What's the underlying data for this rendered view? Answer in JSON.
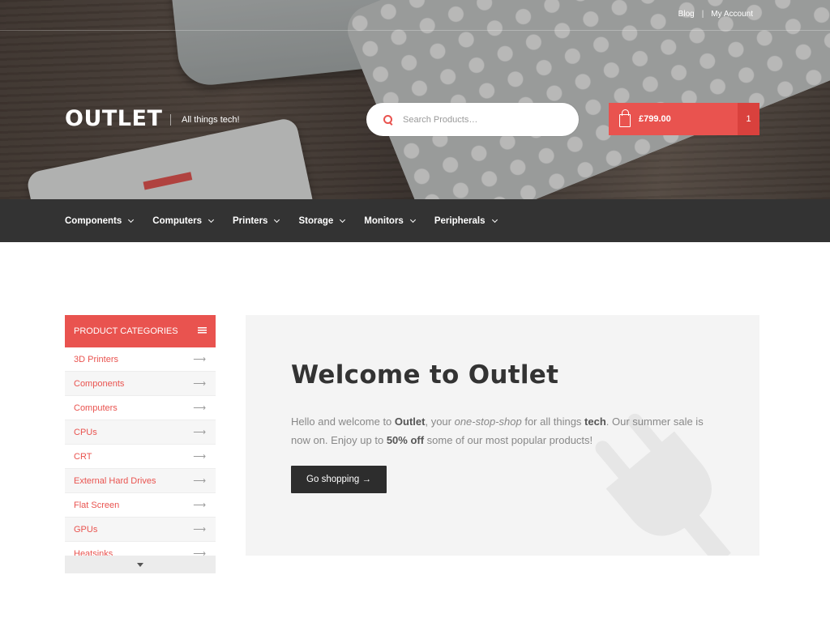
{
  "top_links": {
    "blog": "Blog",
    "separator": "|",
    "account": "My Account"
  },
  "brand": {
    "logo": "OUTLET",
    "tagline": "All things tech!"
  },
  "search": {
    "placeholder": "Search Products…"
  },
  "cart": {
    "total": "£799.00",
    "count": "1"
  },
  "nav": {
    "items": [
      {
        "label": "Components"
      },
      {
        "label": "Computers"
      },
      {
        "label": "Printers"
      },
      {
        "label": "Storage"
      },
      {
        "label": "Monitors"
      },
      {
        "label": "Peripherals"
      }
    ]
  },
  "sidebar": {
    "title": "PRODUCT CATEGORIES",
    "arrow": "⟶",
    "items": [
      {
        "label": "3D Printers"
      },
      {
        "label": "Components"
      },
      {
        "label": "Computers"
      },
      {
        "label": "CPUs"
      },
      {
        "label": "CRT"
      },
      {
        "label": "External Hard Drives"
      },
      {
        "label": "Flat Screen"
      },
      {
        "label": "GPUs"
      },
      {
        "label": "Heatsinks"
      }
    ]
  },
  "welcome": {
    "heading": "Welcome to Outlet",
    "intro_1": "Hello and welcome to ",
    "intro_brand": "Outlet",
    "intro_2": ", your ",
    "intro_em": "one-stop-shop",
    "intro_3": " for all things ",
    "intro_tech": "tech",
    "intro_4": ". Our summer sale is now on. Enjoy up to ",
    "intro_discount": "50% off",
    "intro_5": " some of our most popular products!",
    "button": "Go shopping →"
  },
  "colors": {
    "accent": "#e9534f",
    "nav_bg": "#333333",
    "button_bg": "#2d2d2d"
  }
}
